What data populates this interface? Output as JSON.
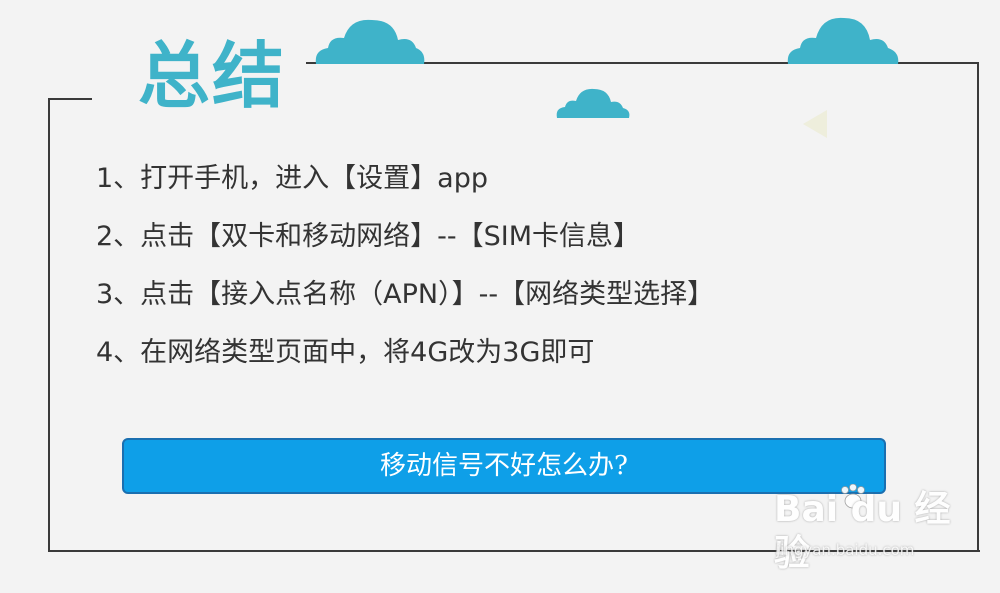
{
  "title": "总结",
  "steps": [
    "1、打开手机，进入【设置】app",
    "2、点击【双卡和移动网络】--【SIM卡信息】",
    "3、点击【接入点名称（APN）】--【网络类型选择】",
    "4、在网络类型页面中，将4G改为3G即可"
  ],
  "cta_label": "移动信号不好怎么办?",
  "watermark": {
    "brand": "Bai du 经验",
    "url": "jingyan.baidu.com"
  },
  "colors": {
    "title": "#3fb3c9",
    "cloud": "#3fb3c9",
    "button_fill": "#0e9fe8",
    "button_border": "#1a6fb0",
    "body_text": "#333333",
    "frame": "#3a3a3a"
  },
  "icons": [
    "cloud-icon",
    "triangle-decoration",
    "paw-icon"
  ]
}
